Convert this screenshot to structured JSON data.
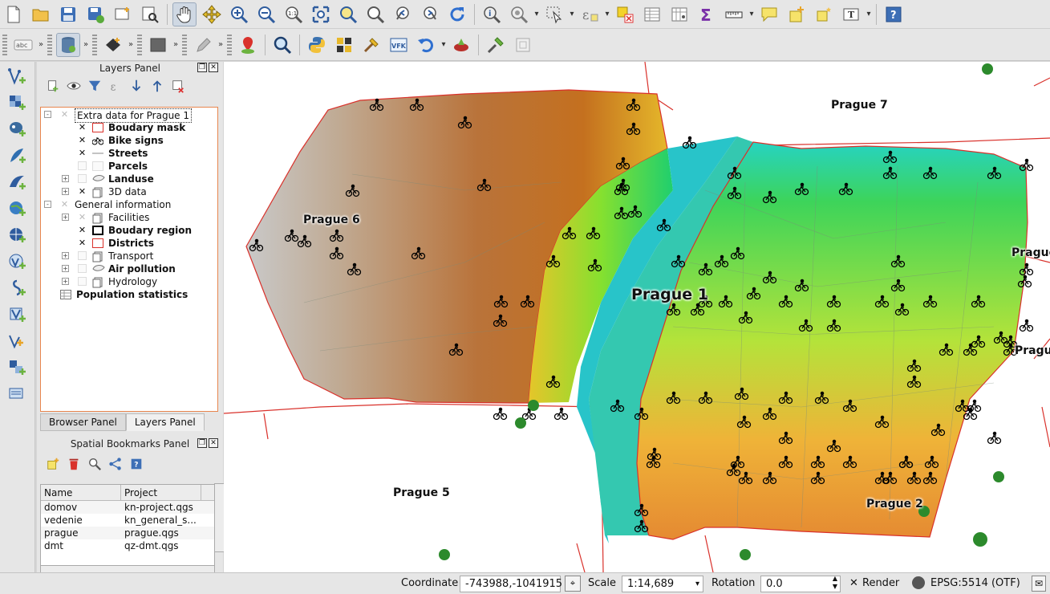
{
  "toolbar_top": {
    "icons": [
      "new-project-icon",
      "open-project-icon",
      "save-project-icon",
      "save-as-icon",
      "new-print-layout-icon",
      "layout-manager-icon",
      "pan-icon",
      "pan-to-selection-icon",
      "zoom-in-icon",
      "zoom-out-icon",
      "zoom-native-icon",
      "zoom-full-icon",
      "zoom-to-selection-icon",
      "zoom-to-layer-icon",
      "zoom-last-icon",
      "zoom-next-icon",
      "refresh-icon",
      "identify-icon",
      "measure-zoom-icon",
      "select-icon",
      "expression-select-icon",
      "deselect-icon",
      "attribute-table-icon",
      "field-calculator-icon",
      "statistics-sigma-icon",
      "measure-icon",
      "annotation-icon",
      "new-bookmark-icon",
      "show-bookmarks-icon",
      "text-annotation-icon",
      "help-icon"
    ]
  },
  "toolbar_second": {
    "labelling_label": "abc"
  },
  "layers_panel": {
    "title": "Layers Panel",
    "items": [
      {
        "label": "Extra data for Prague 1",
        "level": 0,
        "bold": false,
        "checked": "partial",
        "expand": "-",
        "selected": true
      },
      {
        "label": "Boudary mask",
        "level": 1,
        "bold": true,
        "checked": "on",
        "symbol": "red-square"
      },
      {
        "label": "Bike signs",
        "level": 1,
        "bold": true,
        "checked": "on",
        "symbol": "bike"
      },
      {
        "label": "Streets",
        "level": 1,
        "bold": true,
        "checked": "on",
        "symbol": "line"
      },
      {
        "label": "Parcels",
        "level": 1,
        "bold": true,
        "checked": "off",
        "symbol": "grey-square"
      },
      {
        "label": "Landuse",
        "level": 1,
        "bold": true,
        "checked": "off",
        "expand": "+",
        "symbol": "polygon"
      },
      {
        "label": "3D data",
        "level": 1,
        "bold": false,
        "checked": "on",
        "expand": "+",
        "symbol": "group"
      },
      {
        "label": "General information",
        "level": 0,
        "bold": false,
        "checked": "partial",
        "expand": "-"
      },
      {
        "label": "Facilities",
        "level": 1,
        "bold": false,
        "checked": "partial",
        "expand": "+",
        "symbol": "group"
      },
      {
        "label": "Boudary region",
        "level": 1,
        "bold": true,
        "checked": "on",
        "symbol": "black-square"
      },
      {
        "label": "Districts",
        "level": 1,
        "bold": true,
        "checked": "on",
        "symbol": "red-square"
      },
      {
        "label": "Transport",
        "level": 1,
        "bold": false,
        "checked": "off",
        "expand": "+",
        "symbol": "group"
      },
      {
        "label": "Air pollution",
        "level": 1,
        "bold": true,
        "checked": "off",
        "expand": "+",
        "symbol": "polygon"
      },
      {
        "label": "Hydrology",
        "level": 1,
        "bold": false,
        "checked": "off",
        "expand": "+",
        "symbol": "group"
      },
      {
        "label": "Population statistics",
        "level": 0,
        "bold": true,
        "checked": "none",
        "symbol": "table"
      }
    ]
  },
  "tabs": {
    "browser": "Browser Panel",
    "layers": "Layers Panel"
  },
  "bookmarks_panel": {
    "title": "Spatial Bookmarks Panel",
    "columns": [
      "Name",
      "Project"
    ],
    "rows": [
      [
        "domov",
        "kn-project.qgs"
      ],
      [
        "vedenie",
        "kn_general_s..."
      ],
      [
        "prague",
        "prague.qgs"
      ],
      [
        "dmt",
        "qz-dmt.qgs"
      ]
    ]
  },
  "map": {
    "labels": {
      "prague1": "Prague 1",
      "prague2": "Prague 2",
      "prague5": "Prague 5",
      "prague6": "Prague 6",
      "prague7": "Prague 7",
      "prague3": "Prague",
      "prague8": "Prague"
    }
  },
  "status": {
    "coordinate_label": "Coordinate",
    "coordinate_value": "-743988,-1041915",
    "scale_label": "Scale",
    "scale_value": "1:14,689",
    "rotation_label": "Rotation",
    "rotation_value": "0.0",
    "render_label": "Render",
    "crs_label": "EPSG:5514 (OTF)"
  },
  "colors": {
    "boundary_red": "#d9312b",
    "panel_highlight": "#e8864f",
    "accent_blue": "#1f5fbf"
  }
}
